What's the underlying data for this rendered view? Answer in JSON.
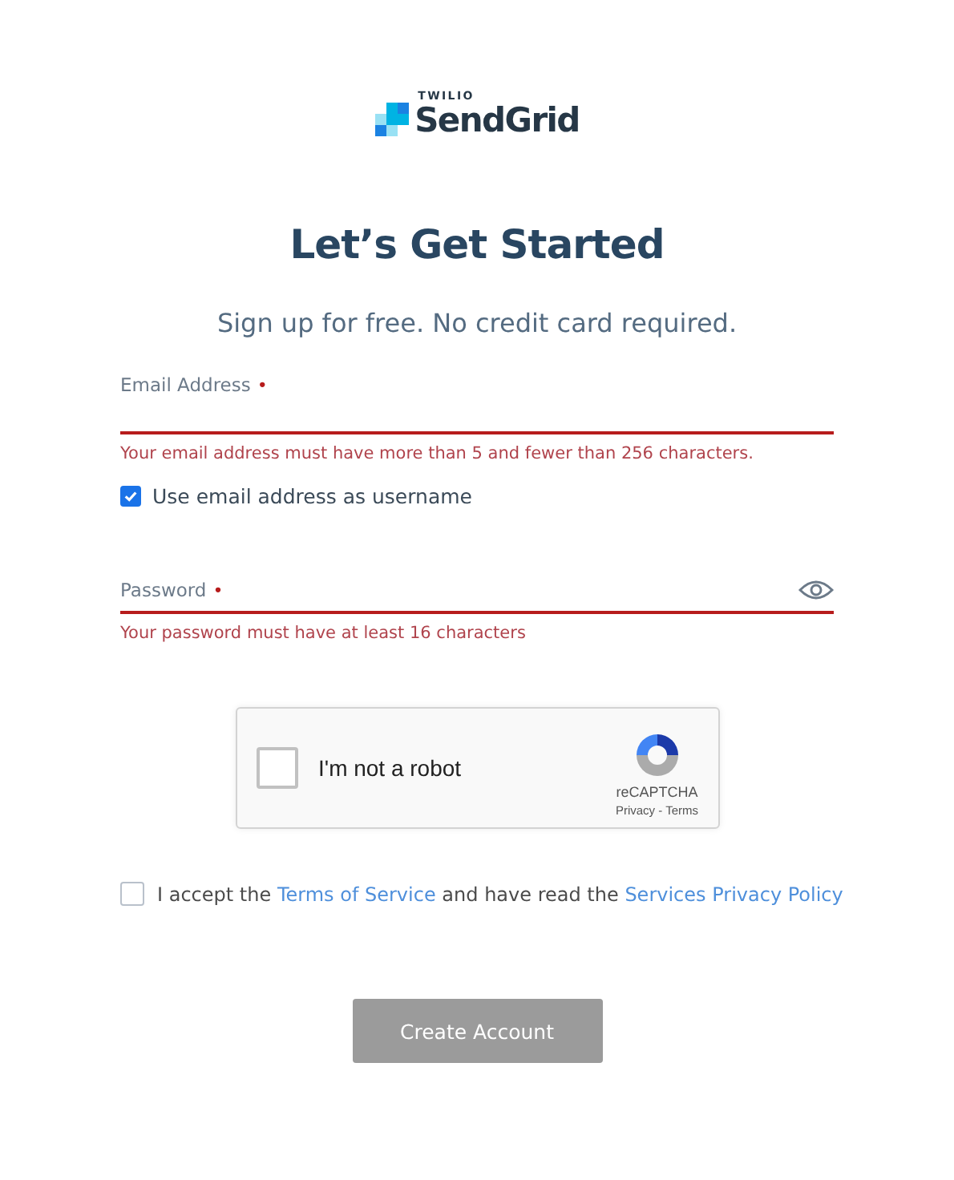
{
  "logo": {
    "company": "TWILIO",
    "product": "SendGrid"
  },
  "title": "Let’s Get Started",
  "subtitle": "Sign up for free. No credit card required.",
  "email": {
    "label": "Email Address",
    "required_mark": "•",
    "error": "Your email address must have more than 5 and fewer than 256 characters.",
    "invalid": true
  },
  "username_option": {
    "label": "Use email address as username",
    "checked": true
  },
  "password": {
    "label": "Password",
    "required_mark": "•",
    "error": "Your password must have at least 16 characters",
    "invalid": true
  },
  "captcha": {
    "label": "I'm not a robot",
    "checked": false,
    "brand": "reCAPTCHA",
    "links": "Privacy - Terms"
  },
  "accept": {
    "checked": false,
    "parts": [
      {
        "kind": "text",
        "text": "I accept the"
      },
      {
        "kind": "link",
        "text": "Terms of Service"
      },
      {
        "kind": "text",
        "text": "and have read the"
      },
      {
        "kind": "link",
        "text": "Services Privacy Policy"
      }
    ]
  },
  "submit": {
    "label": "Create Account",
    "disabled": true
  }
}
